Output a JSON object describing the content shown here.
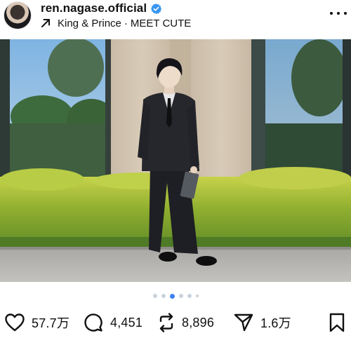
{
  "post": {
    "username": "ren.nagase.official",
    "verified": true,
    "subline": {
      "artist": "King & Prince",
      "separator": "·",
      "song": "MEET CUTE"
    }
  },
  "media": {
    "muted": true,
    "carousel": {
      "total": 6,
      "active_index": 2
    }
  },
  "actions": {
    "likes": "57.7万",
    "comments": "4,451",
    "reposts": "8,896",
    "shares": "1.6万"
  },
  "colors": {
    "verified": "#3897f0",
    "active_dot": "#3b82f6"
  },
  "icons": {
    "verified": "verified-badge-icon",
    "music": "arrow-up-right-icon",
    "more": "more-options-icon",
    "mute": "speaker-muted-icon",
    "like": "heart-icon",
    "comment": "comment-bubble-icon",
    "repost": "repost-icon",
    "share": "send-icon",
    "save": "bookmark-icon"
  }
}
